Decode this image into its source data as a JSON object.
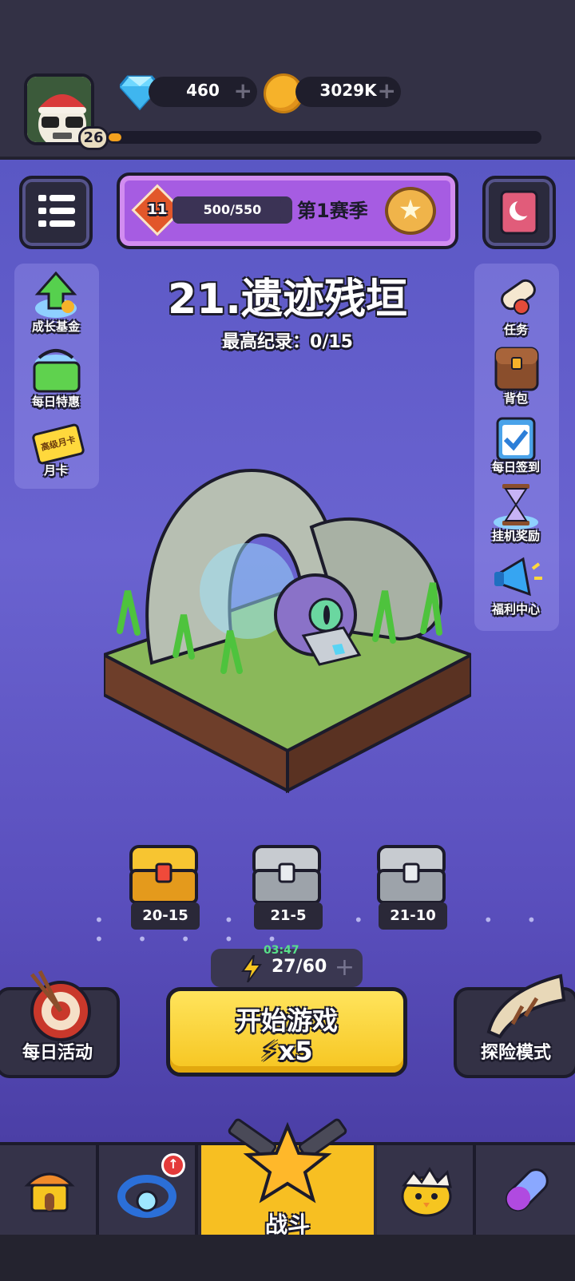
{
  "header": {
    "player_level": "26",
    "xp_fraction": 0.03,
    "gems": "460",
    "coins": "3029K"
  },
  "season": {
    "level": "11",
    "progress": "500/550",
    "progress_fraction": 0.909,
    "label": "第1赛季"
  },
  "left_menu": [
    {
      "label": "成长基金",
      "icon": "growth-fund-icon"
    },
    {
      "label": "每日特惠",
      "icon": "shopping-basket-icon"
    },
    {
      "label": "月卡",
      "card_text": "高级月卡",
      "icon": "monthly-card-icon"
    }
  ],
  "right_menu": [
    {
      "label": "任务",
      "icon": "scroll-icon"
    },
    {
      "label": "背包",
      "icon": "backpack-icon"
    },
    {
      "label": "每日签到",
      "icon": "clipboard-check-icon"
    },
    {
      "label": "挂机奖励",
      "icon": "hourglass-icon"
    },
    {
      "label": "福利中心",
      "icon": "megaphone-icon"
    }
  ],
  "stage": {
    "title": "21.遗迹残垣",
    "record": "最高纪录：0/15"
  },
  "chests": [
    {
      "label": "20-15",
      "type": "gold"
    },
    {
      "label": "21-5",
      "type": "silver"
    },
    {
      "label": "21-10",
      "type": "silver"
    }
  ],
  "energy": {
    "timer": "03:47",
    "amount": "27/60"
  },
  "start": {
    "label": "开始游戏",
    "cost": "x5"
  },
  "daily_activity": {
    "label": "每日活动"
  },
  "adventure": {
    "label": "探险模式"
  },
  "nav": {
    "battle_label": "战斗",
    "tabs": [
      "shop-icon",
      "ring-icon",
      "battle-icon",
      "chick-egg-icon",
      "capsule-icon"
    ]
  },
  "colors": {
    "accent_yellow": "#f7bf22",
    "season_purple": "#a65ce2",
    "background_purple": "#5a57c4"
  }
}
